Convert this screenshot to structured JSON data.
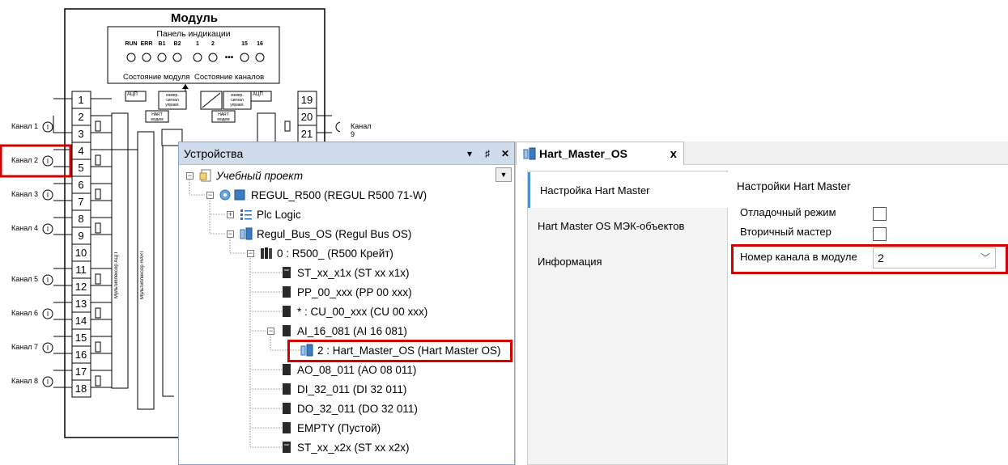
{
  "diagram": {
    "title": "Модуль",
    "indication_title": "Панель индикации",
    "indicators": [
      "RUN",
      "ERR",
      "B1",
      "B2",
      "1",
      "2",
      "15",
      "16"
    ],
    "dots": "•••",
    "module_state_label": "Состояние модуля",
    "channel_state_label": "Состояние каналов",
    "left_terminals": [
      "1",
      "2",
      "3",
      "4",
      "5",
      "6",
      "7",
      "8",
      "9",
      "10",
      "11",
      "12",
      "13",
      "14",
      "15",
      "16",
      "17",
      "18"
    ],
    "right_terminals": [
      "19",
      "20",
      "21"
    ],
    "channels": [
      "Канал 1",
      "Канал 2",
      "Канал 3",
      "Канал 4",
      "Канал 5",
      "Канал 6",
      "Канал 7",
      "Канал 8"
    ],
    "right_channel": "Канал 9",
    "highlighted_channel": "Канал 2",
    "adc_label": "АЦП",
    "signal_label": "измер. сигнал управл.",
    "hart_modem_label": "HART модем",
    "mux_adc_label": "Мультиплексор АЦП",
    "mux_hart_label": "Мультиплексор HART"
  },
  "devices": {
    "title": "Устройства",
    "controls": [
      "▾",
      "♯",
      "✕"
    ],
    "tree": [
      {
        "label": "Учебный проект",
        "italic": true,
        "icon": "project-icon"
      },
      {
        "label": "REGUL_R500 (REGUL R500 71-W)",
        "icon": "plc-icon"
      },
      {
        "label": "Plc Logic",
        "icon": "logic-icon"
      },
      {
        "label": "Regul_Bus_OS (Regul Bus OS)",
        "icon": "bus-icon"
      },
      {
        "label": "0 : R500_ (R500 Крейт)",
        "icon": "rack-icon"
      },
      {
        "label": "ST_xx_x1x (ST xx x1x)",
        "icon": "module-icon"
      },
      {
        "label": "PP_00_xxx (PP 00 xxx)",
        "icon": "module-icon"
      },
      {
        "label": "* : CU_00_xxx (CU 00 xxx)",
        "icon": "module-icon"
      },
      {
        "label": "AI_16_081 (AI 16 081)",
        "icon": "module-icon"
      },
      {
        "label": "2 : Hart_Master_OS (Hart Master OS)",
        "icon": "hart-icon"
      },
      {
        "label": "AO_08_011 (AO 08 011)",
        "icon": "module-icon"
      },
      {
        "label": "DI_32_011 (DI 32 011)",
        "icon": "module-icon"
      },
      {
        "label": "DO_32_011 (DO 32 011)",
        "icon": "module-icon"
      },
      {
        "label": "EMPTY (Пустой)",
        "icon": "module-icon"
      },
      {
        "label": "ST_xx_x2x (ST xx x2x)",
        "icon": "module-icon"
      }
    ]
  },
  "editor": {
    "tab_label": "Hart_Master_OS",
    "close_glyph": "x",
    "nav": [
      "Настройка Hart Master",
      "Hart Master OS МЭК-объектов",
      "Информация"
    ],
    "settings_title": "Настройки Hart Master",
    "debug_mode_label": "Отладочный режим",
    "secondary_master_label": "Вторичный мастер",
    "channel_number_label": "Номер канала в модуле",
    "channel_number_value": "2",
    "combo_arrow": "﹀"
  },
  "colors": {
    "highlight": "#d40000",
    "panel_header": "#cfdcec",
    "accent": "#4b8fd6"
  }
}
